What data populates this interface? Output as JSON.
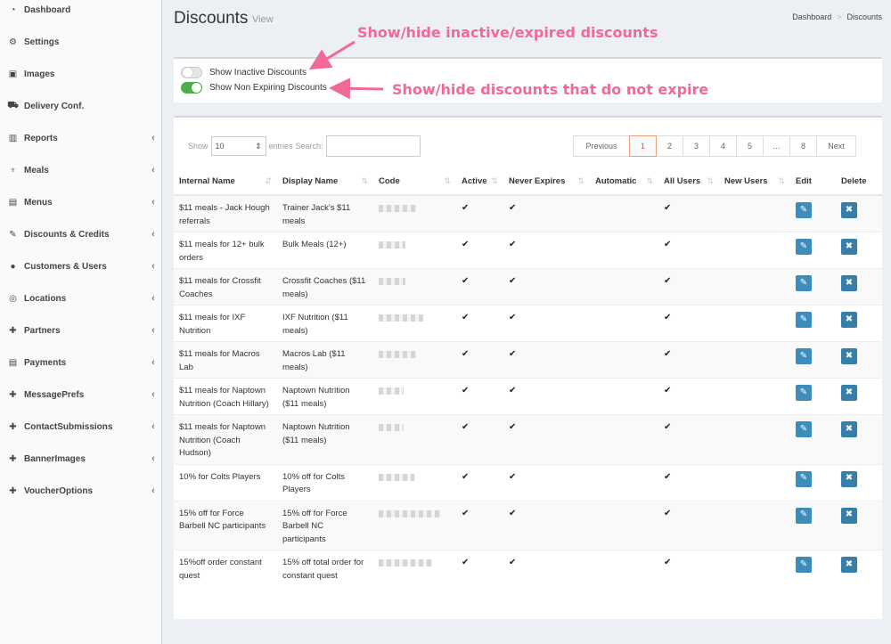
{
  "sidebar": {
    "items": [
      {
        "label": "Dashboard",
        "icon": "dashboard-icon",
        "glyph": "◔",
        "chevron": false
      },
      {
        "label": "Settings",
        "icon": "gear-icon",
        "glyph": "⚙",
        "chevron": false
      },
      {
        "label": "Images",
        "icon": "image-icon",
        "glyph": "▣",
        "chevron": false
      },
      {
        "label": "Delivery Conf.",
        "icon": "car-icon",
        "glyph": "⛟",
        "chevron": false
      },
      {
        "label": "Reports",
        "icon": "bar-chart-icon",
        "glyph": "▥",
        "chevron": true
      },
      {
        "label": "Meals",
        "icon": "cutlery-icon",
        "glyph": "♆",
        "chevron": true
      },
      {
        "label": "Menus",
        "icon": "money-icon",
        "glyph": "▤",
        "chevron": true
      },
      {
        "label": "Discounts & Credits",
        "icon": "magic-icon",
        "glyph": "✎",
        "chevron": true
      },
      {
        "label": "Customers & Users",
        "icon": "user-icon",
        "glyph": "●",
        "chevron": true
      },
      {
        "label": "Locations",
        "icon": "compass-icon",
        "glyph": "◎",
        "chevron": true
      },
      {
        "label": "Partners",
        "icon": "plus-icon",
        "glyph": "✚",
        "chevron": true
      },
      {
        "label": "Payments",
        "icon": "money-icon",
        "glyph": "▤",
        "chevron": true
      },
      {
        "label": "MessagePrefs",
        "icon": "plus-icon",
        "glyph": "✚",
        "chevron": true
      },
      {
        "label": "ContactSubmissions",
        "icon": "plus-icon",
        "glyph": "✚",
        "chevron": true
      },
      {
        "label": "BannerImages",
        "icon": "plus-icon",
        "glyph": "✚",
        "chevron": true
      },
      {
        "label": "VoucherOptions",
        "icon": "plus-icon",
        "glyph": "✚",
        "chevron": true
      }
    ],
    "chevron_glyph": "‹"
  },
  "header": {
    "title": "Discounts",
    "subtitle": "View",
    "breadcrumb": [
      "Dashboard",
      "Discounts"
    ],
    "breadcrumb_sep": ">"
  },
  "filters": {
    "inactive_label": "Show Inactive Discounts",
    "inactive_on": false,
    "nonexpiring_label": "Show Non Expiring Discounts",
    "nonexpiring_on": true
  },
  "annotations": {
    "top": "Show/hide inactive/expired discounts",
    "bottom": "Show/hide discounts that do not expire"
  },
  "table_controls": {
    "show_label": "Show",
    "length_value": "10",
    "entries_label": "entries",
    "search_label": "Search:",
    "search_value": ""
  },
  "pagination": [
    "Previous",
    "1",
    "2",
    "3",
    "4",
    "5",
    "…",
    "8",
    "Next"
  ],
  "pagination_active": "1",
  "columns": [
    "Internal Name",
    "Display Name",
    "Code",
    "Active",
    "Never Expires",
    "Automatic",
    "All Users",
    "New Users",
    "Edit",
    "Delete"
  ],
  "glyphs": {
    "check": "✔",
    "edit": "✎",
    "delete": "✖",
    "sort": "⇅",
    "sort_asc": "⇵",
    "select_arrows": "⇕"
  },
  "rows": [
    {
      "internal": "$11 meals - Jack Hough referrals",
      "display": "Trainer Jack's $11 meals",
      "active": true,
      "never_expires": true,
      "automatic": false,
      "all_users": true,
      "new_users": false
    },
    {
      "internal": "$11 meals for 12+ bulk orders",
      "display": "Bulk Meals (12+)",
      "active": true,
      "never_expires": true,
      "automatic": false,
      "all_users": true,
      "new_users": false
    },
    {
      "internal": "$11 meals for Crossfit Coaches",
      "display": "Crossfit Coaches ($11 meals)",
      "active": true,
      "never_expires": true,
      "automatic": false,
      "all_users": true,
      "new_users": false
    },
    {
      "internal": "$11 meals for IXF Nutrition",
      "display": "IXF Nutrition ($11 meals)",
      "active": true,
      "never_expires": true,
      "automatic": false,
      "all_users": true,
      "new_users": false
    },
    {
      "internal": "$11 meals for Macros Lab",
      "display": "Macros Lab ($11 meals)",
      "active": true,
      "never_expires": true,
      "automatic": false,
      "all_users": true,
      "new_users": false
    },
    {
      "internal": "$11 meals for Naptown Nutrition (Coach Hillary)",
      "display": "Naptown Nutrition ($11 meals)",
      "active": true,
      "never_expires": true,
      "automatic": false,
      "all_users": true,
      "new_users": false
    },
    {
      "internal": "$11 meals for Naptown Nutrition (Coach Hudson)",
      "display": "Naptown Nutrition ($11 meals)",
      "active": true,
      "never_expires": true,
      "automatic": false,
      "all_users": true,
      "new_users": false
    },
    {
      "internal": "10% for Colts Players",
      "display": "10% off for Colts Players",
      "active": true,
      "never_expires": true,
      "automatic": false,
      "all_users": true,
      "new_users": false
    },
    {
      "internal": "15% off for Force Barbell NC participants",
      "display": "15% off for Force Barbell NC participants",
      "active": true,
      "never_expires": true,
      "automatic": false,
      "all_users": true,
      "new_users": false
    },
    {
      "internal": "15%off order constant quest",
      "display": "15% off total order for constant quest",
      "active": true,
      "never_expires": true,
      "automatic": false,
      "all_users": true,
      "new_users": false
    }
  ]
}
